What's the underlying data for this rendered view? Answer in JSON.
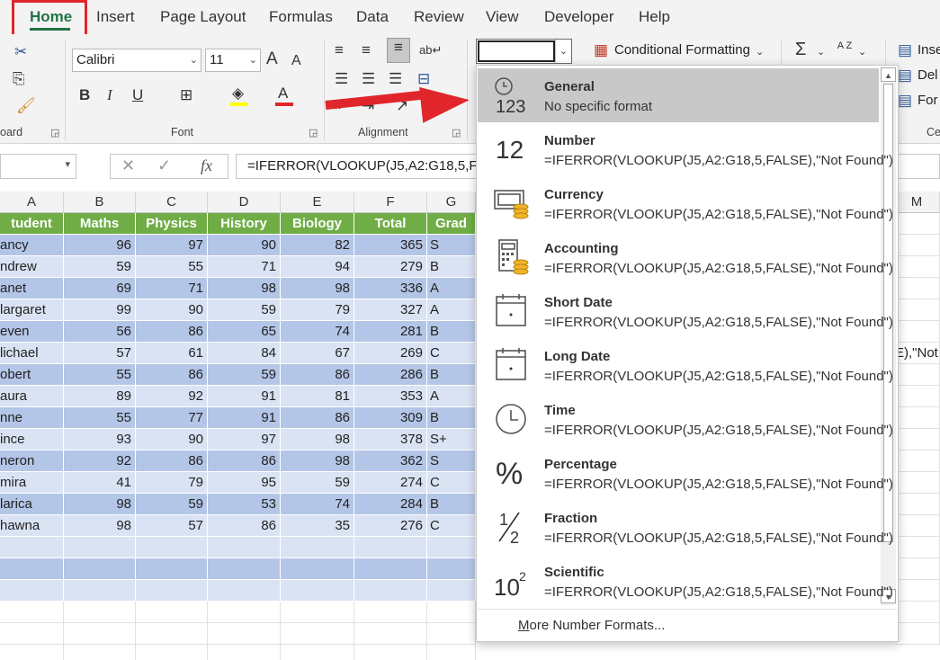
{
  "tabs": [
    "Home",
    "Insert",
    "Page Layout",
    "Formulas",
    "Data",
    "Review",
    "View",
    "Developer",
    "Help"
  ],
  "ribbon": {
    "font_name": "Calibri",
    "font_size": "11",
    "clipboard_label": "oard",
    "font_label": "Font",
    "alignment_label": "Alignment",
    "partial_label": "Ce",
    "conditional_formatting": "Conditional Formatting",
    "insert_label": "Inse",
    "delete_label": "Del",
    "format_label": "For",
    "bold": "B",
    "italic": "I",
    "underline": "U",
    "grow_font": "A",
    "shrink_font": "A",
    "font_color": "A",
    "autosum": "Σ",
    "sort": "A Z"
  },
  "formula_bar": {
    "fx": "fx",
    "formula": "=IFERROR(VLOOKUP(J5,A2:G18,5,FALSE),\"Not Found\")"
  },
  "columns": [
    "A",
    "B",
    "C",
    "D",
    "E",
    "F",
    "G",
    "M"
  ],
  "header_row": [
    "tudent",
    "Maths",
    "Physics",
    "History",
    "Biology",
    "Total",
    "Grad"
  ],
  "rows": [
    [
      "ancy",
      "96",
      "97",
      "90",
      "82",
      "365",
      "S"
    ],
    [
      "ndrew",
      "59",
      "55",
      "71",
      "94",
      "279",
      "B"
    ],
    [
      "anet",
      "69",
      "71",
      "98",
      "98",
      "336",
      "A"
    ],
    [
      "largaret",
      "99",
      "90",
      "59",
      "79",
      "327",
      "A"
    ],
    [
      "even",
      "56",
      "86",
      "65",
      "74",
      "281",
      "B"
    ],
    [
      "lichael",
      "57",
      "61",
      "84",
      "67",
      "269",
      "C"
    ],
    [
      "obert",
      "55",
      "86",
      "59",
      "86",
      "286",
      "B"
    ],
    [
      "aura",
      "89",
      "92",
      "91",
      "81",
      "353",
      "A"
    ],
    [
      "nne",
      "55",
      "77",
      "91",
      "86",
      "309",
      "B"
    ],
    [
      "ince",
      "93",
      "90",
      "97",
      "98",
      "378",
      "S+"
    ],
    [
      "neron",
      "92",
      "86",
      "86",
      "98",
      "362",
      "S"
    ],
    [
      "mira",
      "41",
      "79",
      "95",
      "59",
      "274",
      "C"
    ],
    [
      "larica",
      "98",
      "59",
      "53",
      "74",
      "284",
      "B"
    ],
    [
      "hawna",
      "98",
      "57",
      "86",
      "35",
      "276",
      "C"
    ]
  ],
  "overflow_text": "E),\"Not",
  "number_formats": [
    {
      "name": "General",
      "example": "No specific format",
      "icon": "clock-123-icon"
    },
    {
      "name": "Number",
      "example": "=IFERROR(VLOOKUP(J5,A2:G18,5,FALSE),\"Not Found\")",
      "icon": "number-12-icon"
    },
    {
      "name": "Currency",
      "example": "=IFERROR(VLOOKUP(J5,A2:G18,5,FALSE),\"Not Found\")",
      "icon": "currency-icon"
    },
    {
      "name": "Accounting",
      "example": " =IFERROR(VLOOKUP(J5,A2:G18,5,FALSE),\"Not Found\")",
      "icon": "accounting-icon"
    },
    {
      "name": "Short Date",
      "example": "=IFERROR(VLOOKUP(J5,A2:G18,5,FALSE),\"Not Found\")",
      "icon": "calendar-icon"
    },
    {
      "name": "Long Date",
      "example": "=IFERROR(VLOOKUP(J5,A2:G18,5,FALSE),\"Not Found\")",
      "icon": "calendar-icon"
    },
    {
      "name": "Time",
      "example": "=IFERROR(VLOOKUP(J5,A2:G18,5,FALSE),\"Not Found\")",
      "icon": "clock-icon"
    },
    {
      "name": "Percentage",
      "example": "=IFERROR(VLOOKUP(J5,A2:G18,5,FALSE),\"Not Found\")",
      "icon": "percent-icon"
    },
    {
      "name": "Fraction",
      "example": "=IFERROR(VLOOKUP(J5,A2:G18,5,FALSE),\"Not Found\")",
      "icon": "fraction-icon"
    },
    {
      "name": "Scientific",
      "example": "=IFERROR(VLOOKUP(J5,A2:G18,5,FALSE),\"Not Found\")",
      "icon": "scientific-icon"
    }
  ],
  "more_formats": "More Number Formats...",
  "icon_glyphs": {
    "number": "12",
    "general_num": "123",
    "percent": "%",
    "fraction_num": "1",
    "fraction_den": "2",
    "sci_base": "10",
    "sci_exp": "2"
  },
  "colors": {
    "header_green": "#70ad47",
    "band_dark": "#b4c6e7",
    "band_light": "#dae3f3",
    "annotation_red": "#e0262b",
    "home_underline": "#217346"
  }
}
